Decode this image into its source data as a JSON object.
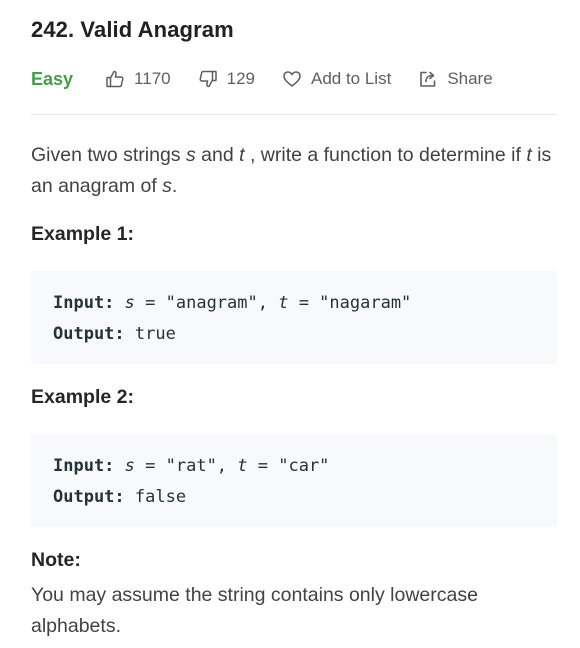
{
  "problem": {
    "title": "242. Valid Anagram",
    "difficulty": "Easy",
    "likes": "1170",
    "dislikes": "129",
    "add_to_list_label": "Add to List",
    "share_label": "Share"
  },
  "description": {
    "part1": "Given two strings ",
    "var_s": "s",
    "part2": " and ",
    "var_t": "t",
    "part3": " , write a function to determine if ",
    "var_t2": "t",
    "part4": " is an anagram of ",
    "var_s2": "s",
    "part5": "."
  },
  "examples": [
    {
      "title": "Example 1:",
      "input_label": "Input:",
      "input_parts": [
        "s",
        " = \"anagram\", ",
        "t",
        " = \"nagaram\""
      ],
      "output_label": "Output:",
      "output_value": " true"
    },
    {
      "title": "Example 2:",
      "input_label": "Input:",
      "input_parts": [
        "s",
        " = \"rat\", ",
        "t",
        " = \"car\""
      ],
      "output_label": "Output:",
      "output_value": " false"
    }
  ],
  "note": {
    "title": "Note:",
    "text": "You may assume the string contains only lowercase alphabets."
  },
  "colors": {
    "difficulty_easy": "#43a047",
    "code_background": "#f7f9fa",
    "divider": "#e6e6e6"
  },
  "icons": {
    "like": "thumbs-up-icon",
    "dislike": "thumbs-down-icon",
    "add_to_list": "heart-icon",
    "share": "share-icon"
  }
}
